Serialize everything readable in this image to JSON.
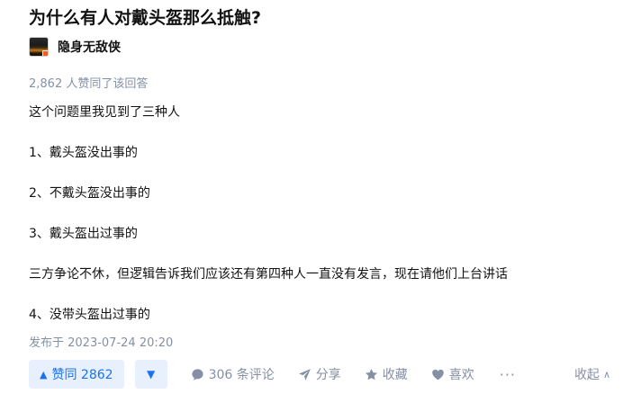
{
  "question": {
    "title": "为什么有人对戴头盔那么抵触?"
  },
  "author": {
    "name": "隐身无敌侠"
  },
  "vote_summary": "2,862 人赞同了该回答",
  "answer": {
    "paragraphs": [
      "这个问题里我见到了三种人",
      "1、戴头盔没出事的",
      "2、不戴头盔没出事的",
      "3、戴头盔出过事的",
      "三方争论不休，但逻辑告诉我们应该还有第四种人一直没有发言，现在请他们上台讲话",
      "4、没带头盔出过事的"
    ],
    "publish_time": "发布于 2023-07-24 20:20"
  },
  "actions": {
    "vote_up_label": "赞同 2862",
    "vote_up_icon": "▲",
    "vote_down_icon": "▼",
    "comment_label": "306 条评论",
    "share_label": "分享",
    "favorite_label": "收藏",
    "like_label": "喜欢",
    "more_label": "···",
    "collapse_label": "收起",
    "collapse_icon": "∧"
  },
  "colors": {
    "accent": "#1772f6",
    "accent_bg": "#e8f0fd",
    "muted": "#8590a6",
    "text": "#121212"
  }
}
